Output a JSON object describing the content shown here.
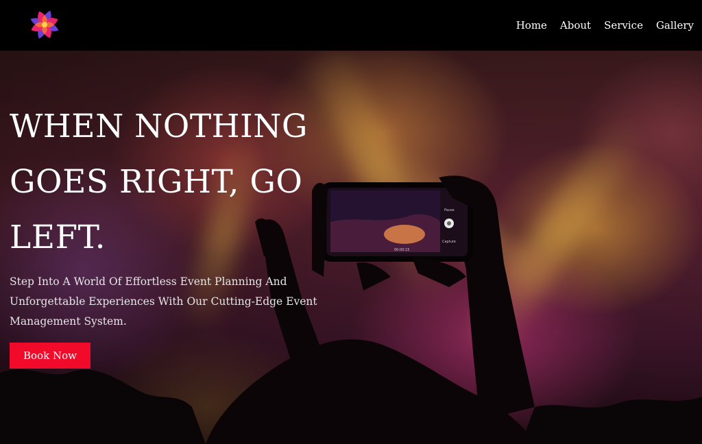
{
  "nav": {
    "links": [
      "Home",
      "About",
      "Service",
      "Gallery"
    ]
  },
  "hero": {
    "headline": "WHEN NOTHING GOES RIGHT, GO LEFT.",
    "subtext": "Step Into A World Of Effortless Event Planning And Unforgettable Experiences With Our Cutting-Edge Event Management System.",
    "cta_label": "Book Now"
  },
  "phone_screen": {
    "top_label": "Pause",
    "bottom_label": "Capture",
    "timer": "00:00:15"
  },
  "colors": {
    "nav_bg": "#000000",
    "cta_bg": "#f20a2a",
    "text": "#ffffff"
  }
}
